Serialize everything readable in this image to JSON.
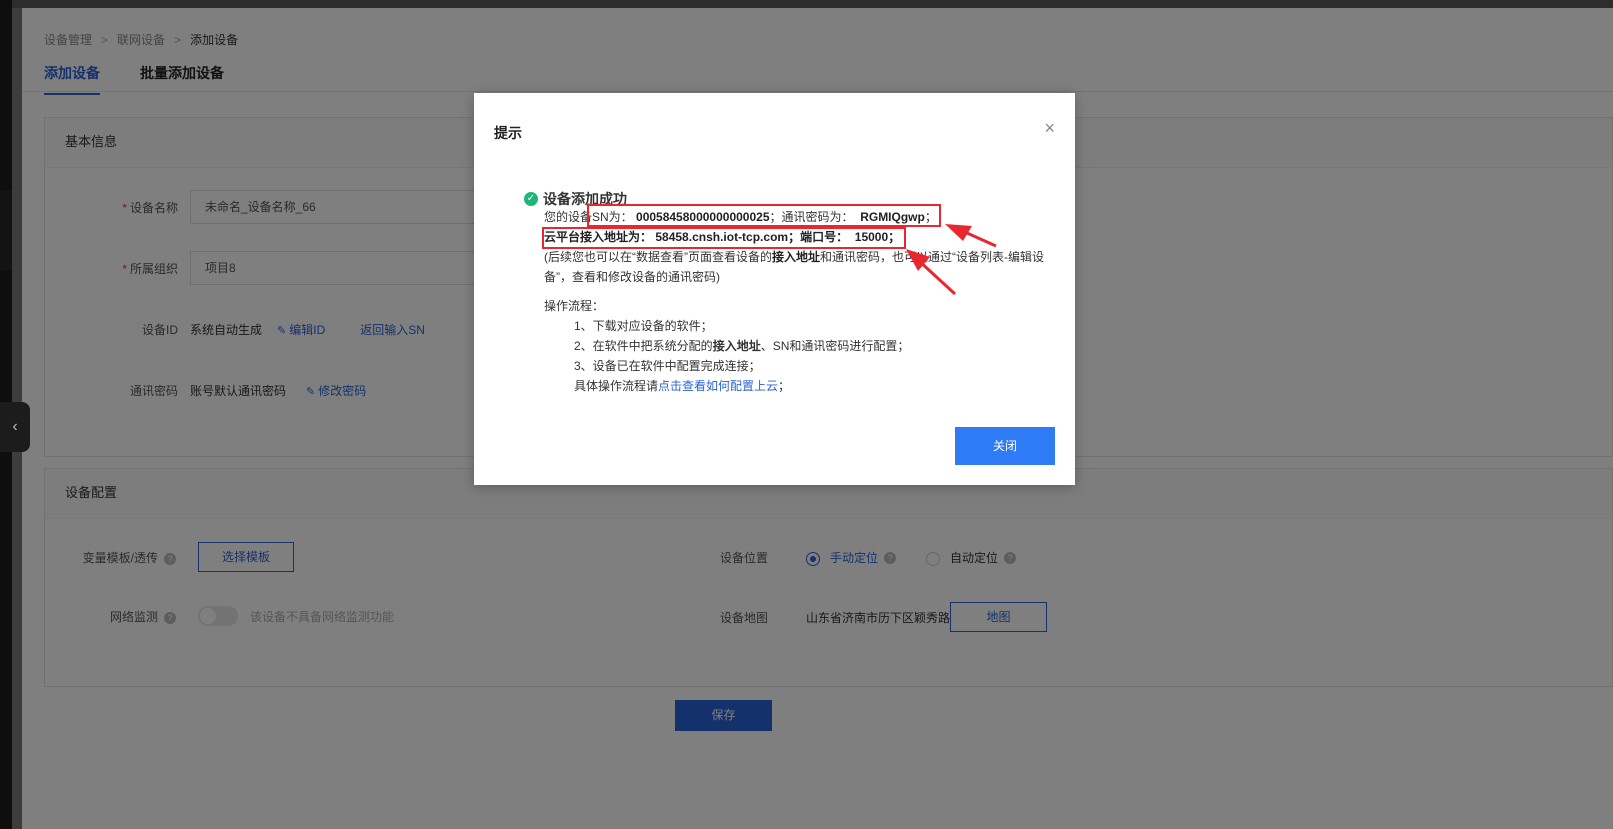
{
  "breadcrumb": [
    "设备管理",
    "联网设备",
    "添加设备"
  ],
  "tabs": [
    "添加设备",
    "批量添加设备"
  ],
  "basic": {
    "title": "基本信息",
    "device_name_label": "设备名称",
    "device_name_value": "未命名_设备名称_66",
    "org_label": "所属组织",
    "org_value": "项目8",
    "device_id_label": "设备ID",
    "device_id_value": "系统自动生成",
    "edit_id": "编辑ID",
    "back_sn": "返回输入SN",
    "password_label": "通讯密码",
    "password_value": "账号默认通讯密码",
    "change_password": "修改密码"
  },
  "config": {
    "title": "设备配置",
    "template_label": "变量模板/透传",
    "template_button": "选择模板",
    "network_label": "网络监测",
    "network_hint": "该设备不具备网络监测功能",
    "location_label": "设备位置",
    "manual": "手动定位",
    "auto": "自动定位",
    "map_label": "设备地图",
    "map_address": "山东省济南市历下区颖秀路",
    "map_button": "地图"
  },
  "save_button": "保存",
  "modal": {
    "title": "提示",
    "close_icon": "×",
    "success": "设备添加成功",
    "line1_prefix": "您的设备SN为：",
    "sn": "00058458000000000025",
    "line1_mid": "；通讯密码为：",
    "password": "RGMIQgwp",
    "line1_end": "；",
    "line2_label": "云平台接入地址为：",
    "address": "58458.cnsh.iot-tcp.com",
    "line2_mid": "；端口号：",
    "port": "15000",
    "line2_end": "；",
    "note_a": "(后续您也可以在“数据查看”页面查看设备的",
    "note_b": "接入地址",
    "note_c": "和通讯密码，也可以通过“设备列表-编辑设",
    "note_d": "备”，查看和修改设备的通讯密码)",
    "flow_title": "操作流程：",
    "step1": "1、下载对应设备的软件；",
    "step2a": "2、在软件中把系统分配的",
    "step2b": "接入地址",
    "step2c": "、SN和通讯密码进行配置；",
    "step3": "3、设备已在软件中配置完成连接；",
    "step4a": "具体操作流程请",
    "step4_link": "点击查看如何配置上云",
    "step4b": "；",
    "close_button": "关闭"
  },
  "colors": {
    "primary": "#2a63d9",
    "success": "#1fb47a",
    "annotation": "#e8272f"
  }
}
